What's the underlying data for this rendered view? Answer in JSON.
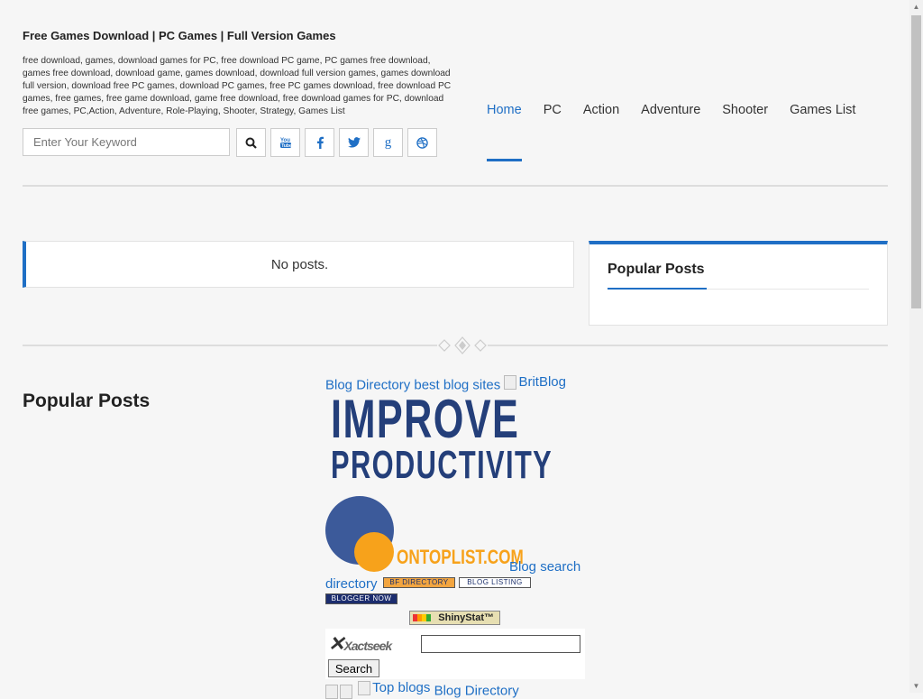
{
  "header": {
    "title": "Free Games Download | PC Games | Full Version Games",
    "description": "free download, games, download games for PC, free download PC game, PC games free download, games free download, download game, games download, download full version games, games download full version, download free PC games, download PC games, free PC games download, free download PC games, free games, free game download, game free download, free download games for PC, download free games, PC,Action, Adventure, Role-Playing, Shooter, Strategy, Games List"
  },
  "search": {
    "placeholder": "Enter Your Keyword"
  },
  "social_icons": [
    "search-icon",
    "youtube-icon",
    "facebook-icon",
    "twitter-icon",
    "google-icon",
    "dribbble-icon"
  ],
  "nav": {
    "items": [
      {
        "label": "Home",
        "active": true
      },
      {
        "label": "PC"
      },
      {
        "label": "Action"
      },
      {
        "label": "Adventure"
      },
      {
        "label": "Shooter"
      },
      {
        "label": "Games List"
      }
    ]
  },
  "main": {
    "no_posts": "No posts."
  },
  "sidebar": {
    "popular_title": "Popular Posts"
  },
  "footer": {
    "popular_title": "Popular Posts",
    "blog_directory": "Blog Directory",
    "best_blog_sites": "best blog sites",
    "britblog": "BritBlog",
    "improve_line1": "IMPROVE",
    "improve_line2": "PRODUCTIVITY",
    "ontoplist": "ONTOPLIST.COM",
    "blog_search": "Blog search",
    "directory": "directory",
    "badge_bf": "BF DIRECTORY",
    "badge_bl": "BLOG LISTING",
    "badge_bn": "BLOGGER NOW",
    "shinystat": "ShinyStat™",
    "xactseek": "Xactseek",
    "xact_button": "Search",
    "top_blogs": "Top blogs",
    "blog_directory_2": "Blog Directory"
  },
  "colors": {
    "accent": "#1f6fc5",
    "background": "#f6f6f6"
  }
}
